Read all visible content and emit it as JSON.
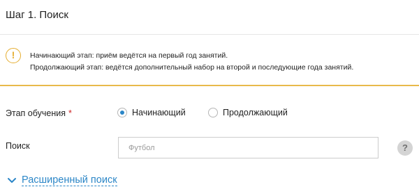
{
  "step": {
    "title": "Шаг 1. Поиск"
  },
  "notice": {
    "icon": "exclamation-icon",
    "icon_glyph": "!",
    "accent_color": "#e5ad2f",
    "line1": "Начинающий этап: приём ведётся на первый год занятий.",
    "line2": "Продолжающий этап: ведётся дополнительный набор на второй и последующие года занятий."
  },
  "stage": {
    "label": "Этап обучения",
    "required_mark": "*",
    "options": [
      {
        "label": "Начинающий",
        "selected": true
      },
      {
        "label": "Продолжающий",
        "selected": false
      }
    ]
  },
  "search": {
    "label": "Поиск",
    "value": "",
    "placeholder": "Футбол",
    "help_glyph": "?"
  },
  "advanced": {
    "label": "Расширенный поиск",
    "icon": "chevron-down-icon",
    "color": "#2b86c7"
  }
}
